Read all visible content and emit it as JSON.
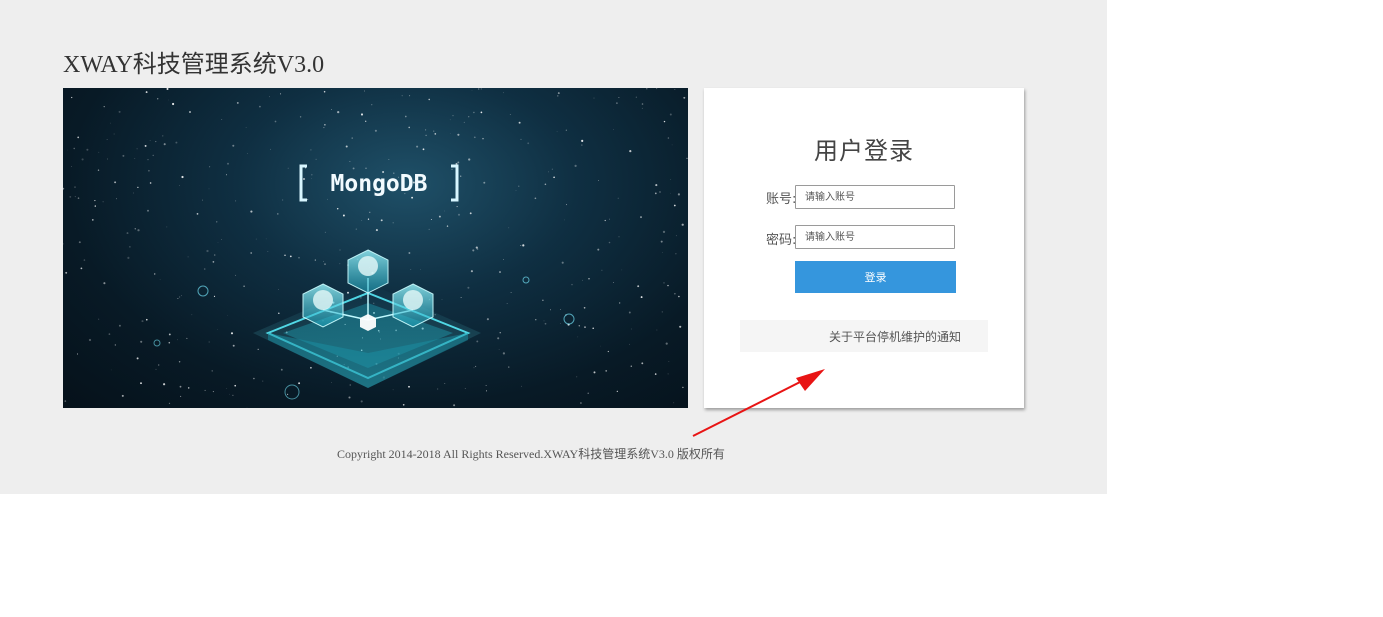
{
  "app": {
    "title": "XWAY科技管理系统V3.0"
  },
  "banner": {
    "logo_text": "MongoDB"
  },
  "login": {
    "heading": "用户登录",
    "account_label": "账号:",
    "account_placeholder": "请输入账号",
    "password_label": "密码:",
    "password_placeholder": "请输入账号",
    "submit_label": "登录"
  },
  "notice": {
    "link_text": "关于平台停机维护的通知"
  },
  "footer": {
    "copyright": "Copyright 2014-2018 All Rights Reserved.XWAY科技管理系统V3.0 版权所有"
  },
  "colors": {
    "background": "#eeeeee",
    "button": "#3596dd",
    "annotation_arrow": "#e81414"
  }
}
